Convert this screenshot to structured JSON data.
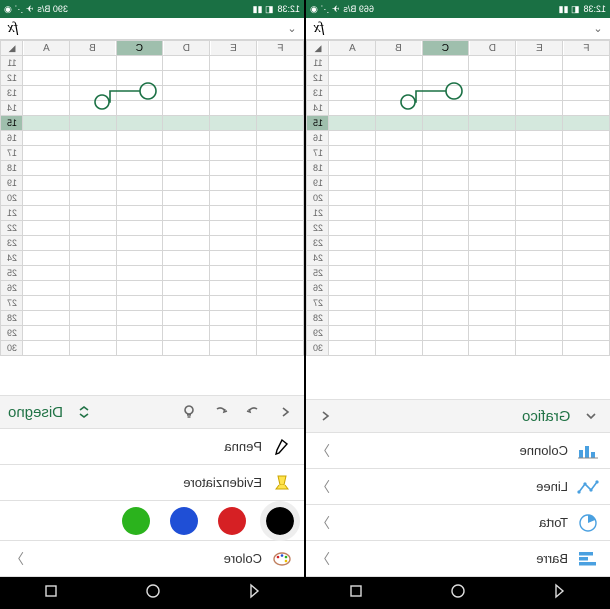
{
  "status_left": {
    "time": "12:38",
    "net": "669 B/s"
  },
  "status_right": {
    "time": "12:38",
    "net": "390 B/s"
  },
  "fx_label": "fx",
  "columns": [
    "A",
    "B",
    "C",
    "D",
    "E",
    "F"
  ],
  "rows": [
    11,
    12,
    13,
    14,
    15,
    16,
    17,
    18,
    19,
    20,
    21,
    22,
    23,
    24,
    25,
    26,
    27,
    28,
    29,
    30
  ],
  "selected_col": "C",
  "selected_row": 15,
  "left_toolbar": {
    "title": "Grafico"
  },
  "right_toolbar": {
    "title": "Disegno"
  },
  "chart_options": [
    {
      "key": "colonne",
      "label": "Colonne"
    },
    {
      "key": "linee",
      "label": "Linee"
    },
    {
      "key": "torta",
      "label": "Torta"
    },
    {
      "key": "barre",
      "label": "Barre"
    }
  ],
  "draw_options": {
    "pen": "Penna",
    "highlighter": "Evidenziatore",
    "color_label": "Colore"
  },
  "colors": [
    {
      "name": "black",
      "hex": "#000000",
      "selected": true
    },
    {
      "name": "red",
      "hex": "#d62024",
      "selected": false
    },
    {
      "name": "blue",
      "hex": "#1f4fd6",
      "selected": false
    },
    {
      "name": "green",
      "hex": "#2bb31d",
      "selected": false
    }
  ]
}
